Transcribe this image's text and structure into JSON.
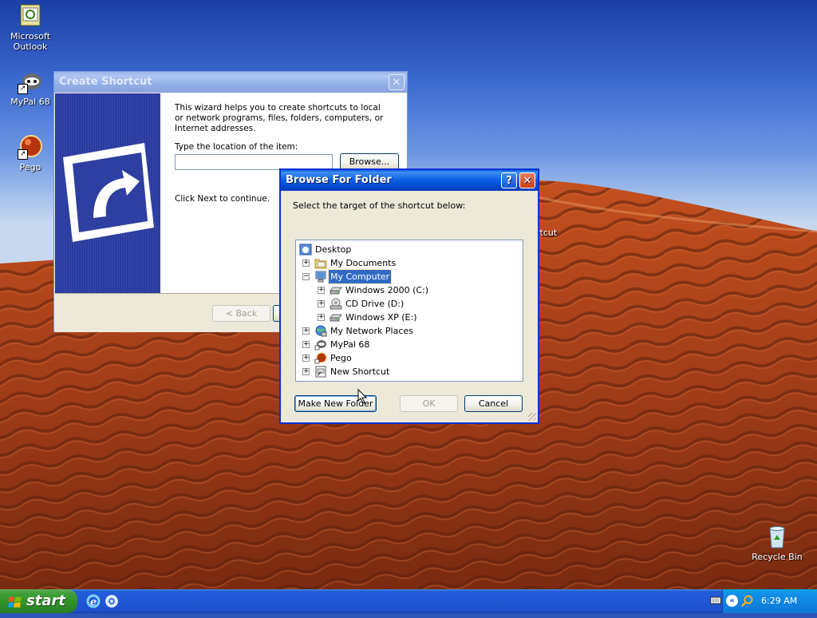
{
  "desktop": {
    "icons": [
      {
        "label": "Microsoft Outlook",
        "icon": "outlook-icon"
      },
      {
        "label": "MyPal 68",
        "icon": "mypal-icon"
      },
      {
        "label": "Pego",
        "icon": "pego-icon"
      },
      {
        "label": "Recycle Bin",
        "icon": "recycle-bin-icon"
      }
    ],
    "partial_icon_label": "rtcut"
  },
  "create_shortcut": {
    "title": "Create Shortcut",
    "intro": "This wizard helps you to create shortcuts to local or network programs, files, folders, computers, or Internet addresses.",
    "location_label": "Type the location of the item:",
    "location_value": "",
    "browse_label": "Browse...",
    "next_hint": "Click Next to continue.",
    "back_label": "< Back"
  },
  "browse_dialog": {
    "title": "Browse For Folder",
    "help_glyph": "?",
    "close_glyph": "✕",
    "prompt": "Select the target of the shortcut below:",
    "tree": [
      {
        "label": "Desktop",
        "icon": "desktop-icon",
        "level": 0,
        "expander": ""
      },
      {
        "label": "My Documents",
        "icon": "folder-icon",
        "level": 1,
        "expander": "+"
      },
      {
        "label": "My Computer",
        "icon": "my-computer-icon",
        "level": 1,
        "expander": "−",
        "selected": true
      },
      {
        "label": "Windows 2000 (C:)",
        "icon": "hard-drive-icon",
        "level": 2,
        "expander": "+"
      },
      {
        "label": "CD Drive (D:)",
        "icon": "cd-drive-icon",
        "level": 2,
        "expander": "+"
      },
      {
        "label": "Windows XP (E:)",
        "icon": "hard-drive-icon",
        "level": 2,
        "expander": "+"
      },
      {
        "label": "My Network Places",
        "icon": "network-places-icon",
        "level": 1,
        "expander": "+"
      },
      {
        "label": "MyPal 68",
        "icon": "mypal-icon",
        "level": 1,
        "expander": "+"
      },
      {
        "label": "Pego",
        "icon": "pego-icon",
        "level": 1,
        "expander": "+"
      },
      {
        "label": "New Shortcut",
        "icon": "shortcut-icon",
        "level": 1,
        "expander": "+"
      }
    ],
    "make_new_folder_label": "Make New Folder",
    "ok_label": "OK",
    "cancel_label": "Cancel"
  },
  "taskbar": {
    "start_label": "start",
    "quick_launch": [
      "internet-explorer-icon",
      "outlook-express-icon"
    ],
    "clock": "6:29 AM"
  },
  "colors": {
    "title_active": "#0a5ee3",
    "selection": "#316ac5",
    "start_green": "#3c9e36",
    "taskbar_blue": "#245edb"
  }
}
